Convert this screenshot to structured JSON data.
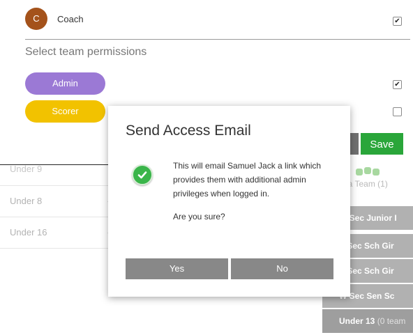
{
  "form": {
    "member": {
      "avatar_letter": "C",
      "label": "Coach",
      "checked": true
    },
    "permissions_heading": "Select team permissions",
    "permissions": [
      {
        "label": "Admin",
        "color": "#9b79d5",
        "checked": true
      },
      {
        "label": "Scorer",
        "color": "#f2c200",
        "checked": false
      }
    ],
    "save_label": "Save"
  },
  "background_list": {
    "rows": [
      {
        "label": "Under 9"
      },
      {
        "label": "Under 8"
      },
      {
        "label": "Under 16"
      }
    ]
  },
  "right_panel": {
    "team_count_label": "na Team (1)",
    "bars": [
      {
        "label": "W Sec Junior I"
      },
      {
        "label": "V Sec Sch Gir"
      },
      {
        "label": "V Sec Sch Gir"
      },
      {
        "label": "W Sec Sen Sc"
      },
      {
        "label": "Under 13",
        "suffix": "(0 team"
      }
    ]
  },
  "modal": {
    "title": "Send Access Email",
    "message": "This will email Samuel Jack a link which provides them with additional admin privileges when logged in.",
    "question": "Are you sure?",
    "yes_label": "Yes",
    "no_label": "No",
    "icon": "check-circle-icon"
  },
  "colors": {
    "save": "#2aa63a",
    "modal_button": "#888888",
    "avatar": "#a4521b",
    "success": "#3ab54a"
  }
}
